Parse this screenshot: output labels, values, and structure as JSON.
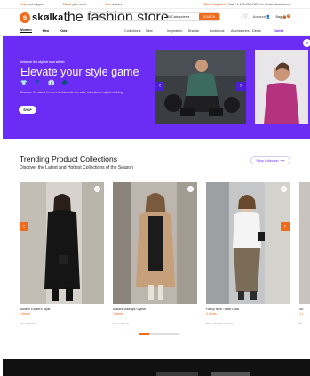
{
  "topbar": {
    "links": [
      {
        "strong": "Help",
        "text": "and support"
      },
      {
        "strong": "Track",
        "text": "your order"
      },
      {
        "strong": "Our",
        "text": "articles"
      }
    ],
    "support": {
      "strong": "Need support ?",
      "text": "Call +1 123-456-7890 for Instant Assistance"
    }
  },
  "header": {
    "logo_word": "skølka",
    "logo_tagline": "the fashion store",
    "search_placeholder": "Search",
    "search_category": "All Categories",
    "search_button": "SEARCH",
    "account_label": "Account",
    "bag_label": "Bag",
    "bag_count": "0"
  },
  "nav": {
    "genders": [
      "Women",
      "Men",
      "Kids"
    ],
    "categories": [
      "Collections",
      "New",
      "Inspiration",
      "Brands",
      "Lookbook",
      "Accessories",
      "Deals",
      "Outlet"
    ]
  },
  "hero": {
    "eyebrow": "Unleash the stylish man within",
    "title": "Elevate your style game",
    "description": "Discover the latest in men's fashion with our wide selection of stylish clothing.",
    "button": "SHOP",
    "icons": [
      "tshirt-icon",
      "pants-icon",
      "shirt-icon",
      "hoodie-icon"
    ]
  },
  "collections": {
    "title": "Trending Product Collections",
    "subtitle": "Discover the Latest and Hottest Collections of the Season",
    "shop_button": "Shop Collection",
    "cards": [
      {
        "name": "Modern Eastern Style",
        "items": "1 Items",
        "brands": "BELLA BEATE"
      },
      {
        "name": "Autumn Allways Stylish",
        "items": "1 Items",
        "brands": "BELLA BEATE"
      },
      {
        "name": "Fancy New Ticket Look",
        "items": "2 Items",
        "brands": "BELLA BEATE  ZALORA"
      },
      {
        "name": "Su",
        "items": "1 I",
        "brands": "BE"
      }
    ]
  },
  "colors": {
    "accent": "#f26b1d",
    "hero": "#6b2cf5",
    "purple_text": "#6a2ff4"
  }
}
